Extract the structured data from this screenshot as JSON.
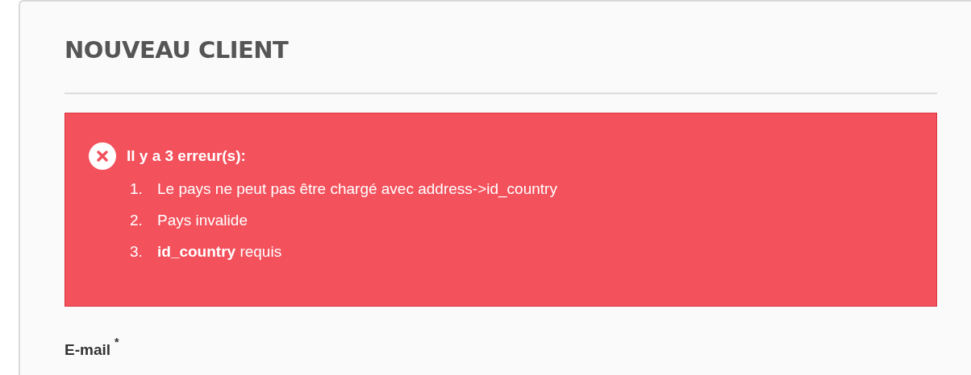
{
  "title": "NOUVEAU CLIENT",
  "alert": {
    "heading": "Il y a 3 erreur(s):",
    "errors": [
      {
        "number": "1.",
        "text": "Le pays ne peut pas être chargé avec address->id_country"
      },
      {
        "number": "2.",
        "text": "Pays invalide"
      },
      {
        "number": "3.",
        "text": "**id_country** requis"
      }
    ]
  },
  "field": {
    "label": "E-mail",
    "required_mark": "*"
  }
}
